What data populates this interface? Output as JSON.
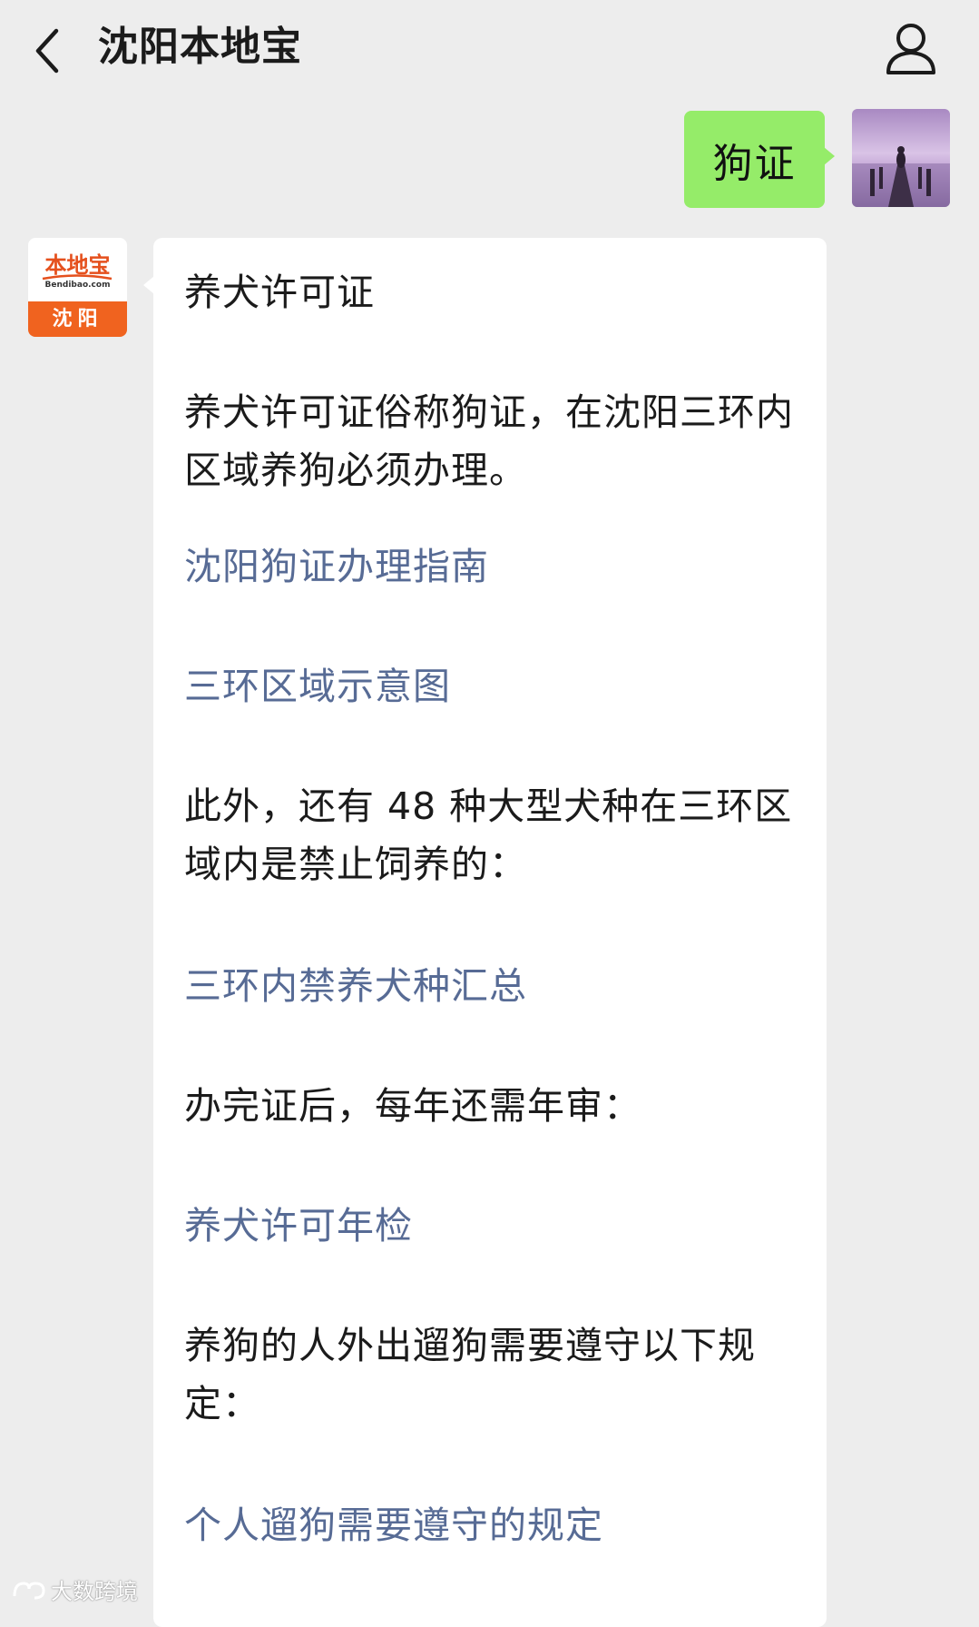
{
  "header": {
    "title": "沈阳本地宝"
  },
  "outgoing": {
    "text": "狗证"
  },
  "bot": {
    "avatar": {
      "brand": "本地宝",
      "domain": "Bendibao.com",
      "city": "沈阳"
    },
    "message": {
      "title": "养犬许可证",
      "p1": "养犬许可证俗称狗证，在沈阳三环内区域养狗必须办理。",
      "link1": "沈阳狗证办理指南",
      "link2": "三环区域示意图",
      "p2": "此外，还有 48 种大型犬种在三环区域内是禁止饲养的：",
      "link3": "三环内禁养犬种汇总",
      "p3": "办完证后，每年还需年审：",
      "link4": "养犬许可年检",
      "p4": "养狗的人外出遛狗需要遵守以下规定：",
      "link5": "个人遛狗需要遵守的规定"
    }
  },
  "watermark": {
    "text": "大数跨境"
  },
  "colors": {
    "background": "#ededed",
    "outgoing_bubble": "#95ec69",
    "incoming_bubble": "#ffffff",
    "link": "#576b95",
    "brand_orange": "#f0631f"
  }
}
